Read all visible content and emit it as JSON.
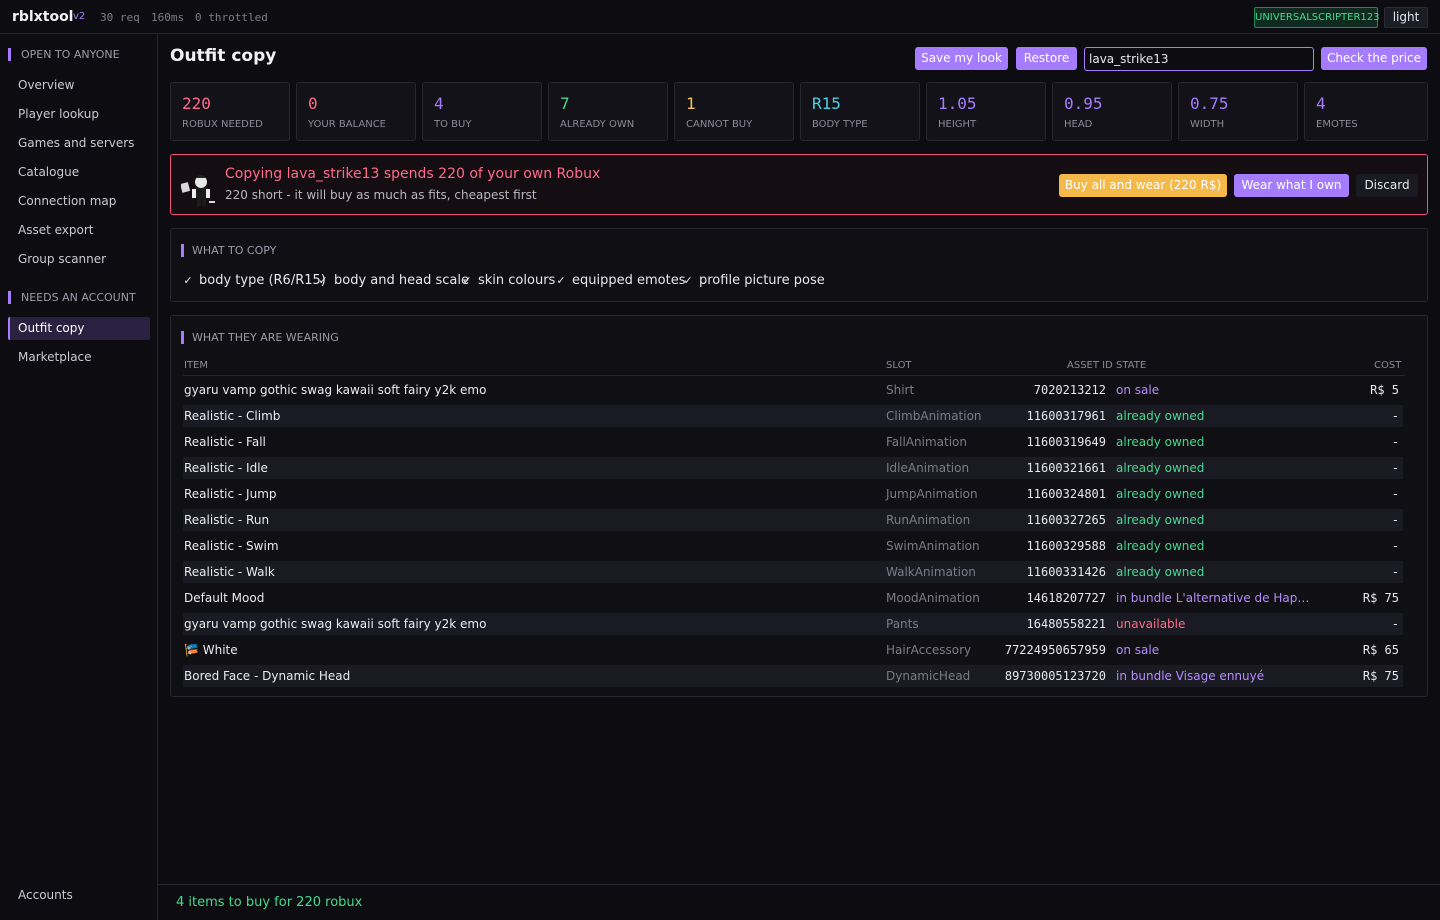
{
  "topbar": {
    "brand": "rblxtool",
    "version": "v2",
    "requests": "30 req",
    "latency": "160ms",
    "throttled": "0 throttled",
    "user": "UNIVERSALSCRIPTER123",
    "theme_toggle": "light"
  },
  "sidebar": {
    "section_open": "OPEN TO ANYONE",
    "open_items": [
      "Overview",
      "Player lookup",
      "Games and servers",
      "Catalogue",
      "Connection map",
      "Asset export",
      "Group scanner"
    ],
    "section_account": "NEEDS AN ACCOUNT",
    "account_items": [
      "Outfit copy",
      "Marketplace"
    ],
    "active_item": "Outfit copy",
    "bottom_item": "Accounts"
  },
  "main": {
    "title": "Outfit copy",
    "save_look": "Save my look",
    "restore": "Restore",
    "username_value": "lava_strike13",
    "check_price": "Check the price"
  },
  "stats": [
    {
      "value": "220",
      "label": "ROBUX NEEDED",
      "color": "#ff6b8c"
    },
    {
      "value": "0",
      "label": "YOUR BALANCE",
      "color": "#ff6b8c"
    },
    {
      "value": "4",
      "label": "TO BUY",
      "color": "#a67cff"
    },
    {
      "value": "7",
      "label": "ALREADY OWN",
      "color": "#47d98f"
    },
    {
      "value": "1",
      "label": "CANNOT BUY",
      "color": "#f5c451"
    },
    {
      "value": "R15",
      "label": "BODY TYPE",
      "color": "#4dd0e1"
    },
    {
      "value": "1.05",
      "label": "HEIGHT",
      "color": "#a67cff"
    },
    {
      "value": "0.95",
      "label": "HEAD",
      "color": "#a67cff"
    },
    {
      "value": "0.75",
      "label": "WIDTH",
      "color": "#a67cff"
    },
    {
      "value": "4",
      "label": "EMOTES",
      "color": "#a67cff"
    }
  ],
  "alert": {
    "title": "Copying lava_strike13 spends 220 of your own Robux",
    "subtitle": "220 short - it will buy as much as fits, cheapest first",
    "buy_all": "Buy all and wear  (220 R$)",
    "wear_owned": "Wear what I own",
    "discard": "Discard"
  },
  "copy_panel": {
    "heading": "WHAT TO COPY",
    "options": [
      "body type (R6/R15)",
      "body and head scale",
      "skin colours",
      "equipped emotes",
      "profile picture pose"
    ]
  },
  "wearing_panel": {
    "heading": "WHAT THEY ARE WEARING",
    "columns": {
      "item": "ITEM",
      "slot": "SLOT",
      "asset_id": "ASSET ID",
      "state": "STATE",
      "cost": "COST"
    },
    "rows": [
      {
        "item": "gyaru vamp gothic swag kawaii soft fairy y2k emo",
        "slot": "Shirt",
        "asset_id": "7020213212",
        "state": "on sale",
        "state_color": "#b58cff",
        "cost": "R$ 5"
      },
      {
        "item": "Realistic - Climb",
        "slot": "ClimbAnimation",
        "asset_id": "11600317961",
        "state": "already owned",
        "state_color": "#47d98f",
        "cost": "-"
      },
      {
        "item": "Realistic - Fall",
        "slot": "FallAnimation",
        "asset_id": "11600319649",
        "state": "already owned",
        "state_color": "#47d98f",
        "cost": "-"
      },
      {
        "item": "Realistic - Idle",
        "slot": "IdleAnimation",
        "asset_id": "11600321661",
        "state": "already owned",
        "state_color": "#47d98f",
        "cost": "-"
      },
      {
        "item": "Realistic - Jump",
        "slot": "JumpAnimation",
        "asset_id": "11600324801",
        "state": "already owned",
        "state_color": "#47d98f",
        "cost": "-"
      },
      {
        "item": "Realistic - Run",
        "slot": "RunAnimation",
        "asset_id": "11600327265",
        "state": "already owned",
        "state_color": "#47d98f",
        "cost": "-"
      },
      {
        "item": "Realistic - Swim",
        "slot": "SwimAnimation",
        "asset_id": "11600329588",
        "state": "already owned",
        "state_color": "#47d98f",
        "cost": "-"
      },
      {
        "item": "Realistic - Walk",
        "slot": "WalkAnimation",
        "asset_id": "11600331426",
        "state": "already owned",
        "state_color": "#47d98f",
        "cost": "-"
      },
      {
        "item": "Default Mood",
        "slot": "MoodAnimation",
        "asset_id": "14618207727",
        "state": "in bundle L'alternative de Hap…",
        "state_color": "#b58cff",
        "cost": "R$ 75"
      },
      {
        "item": "gyaru vamp gothic swag kawaii soft fairy y2k emo",
        "slot": "Pants",
        "asset_id": "16480558221",
        "state": "unavailable",
        "state_color": "#ff6b8c",
        "cost": "-"
      },
      {
        "item": "🎏 White",
        "slot": "HairAccessory",
        "asset_id": "77224950657959",
        "state": "on sale",
        "state_color": "#b58cff",
        "cost": "R$ 65"
      },
      {
        "item": "Bored Face - Dynamic Head",
        "slot": "DynamicHead",
        "asset_id": "89730005123720",
        "state": "in bundle Visage ennuyé",
        "state_color": "#b58cff",
        "cost": "R$ 75"
      }
    ]
  },
  "footer": {
    "summary": "4 items to buy for 220 robux"
  }
}
